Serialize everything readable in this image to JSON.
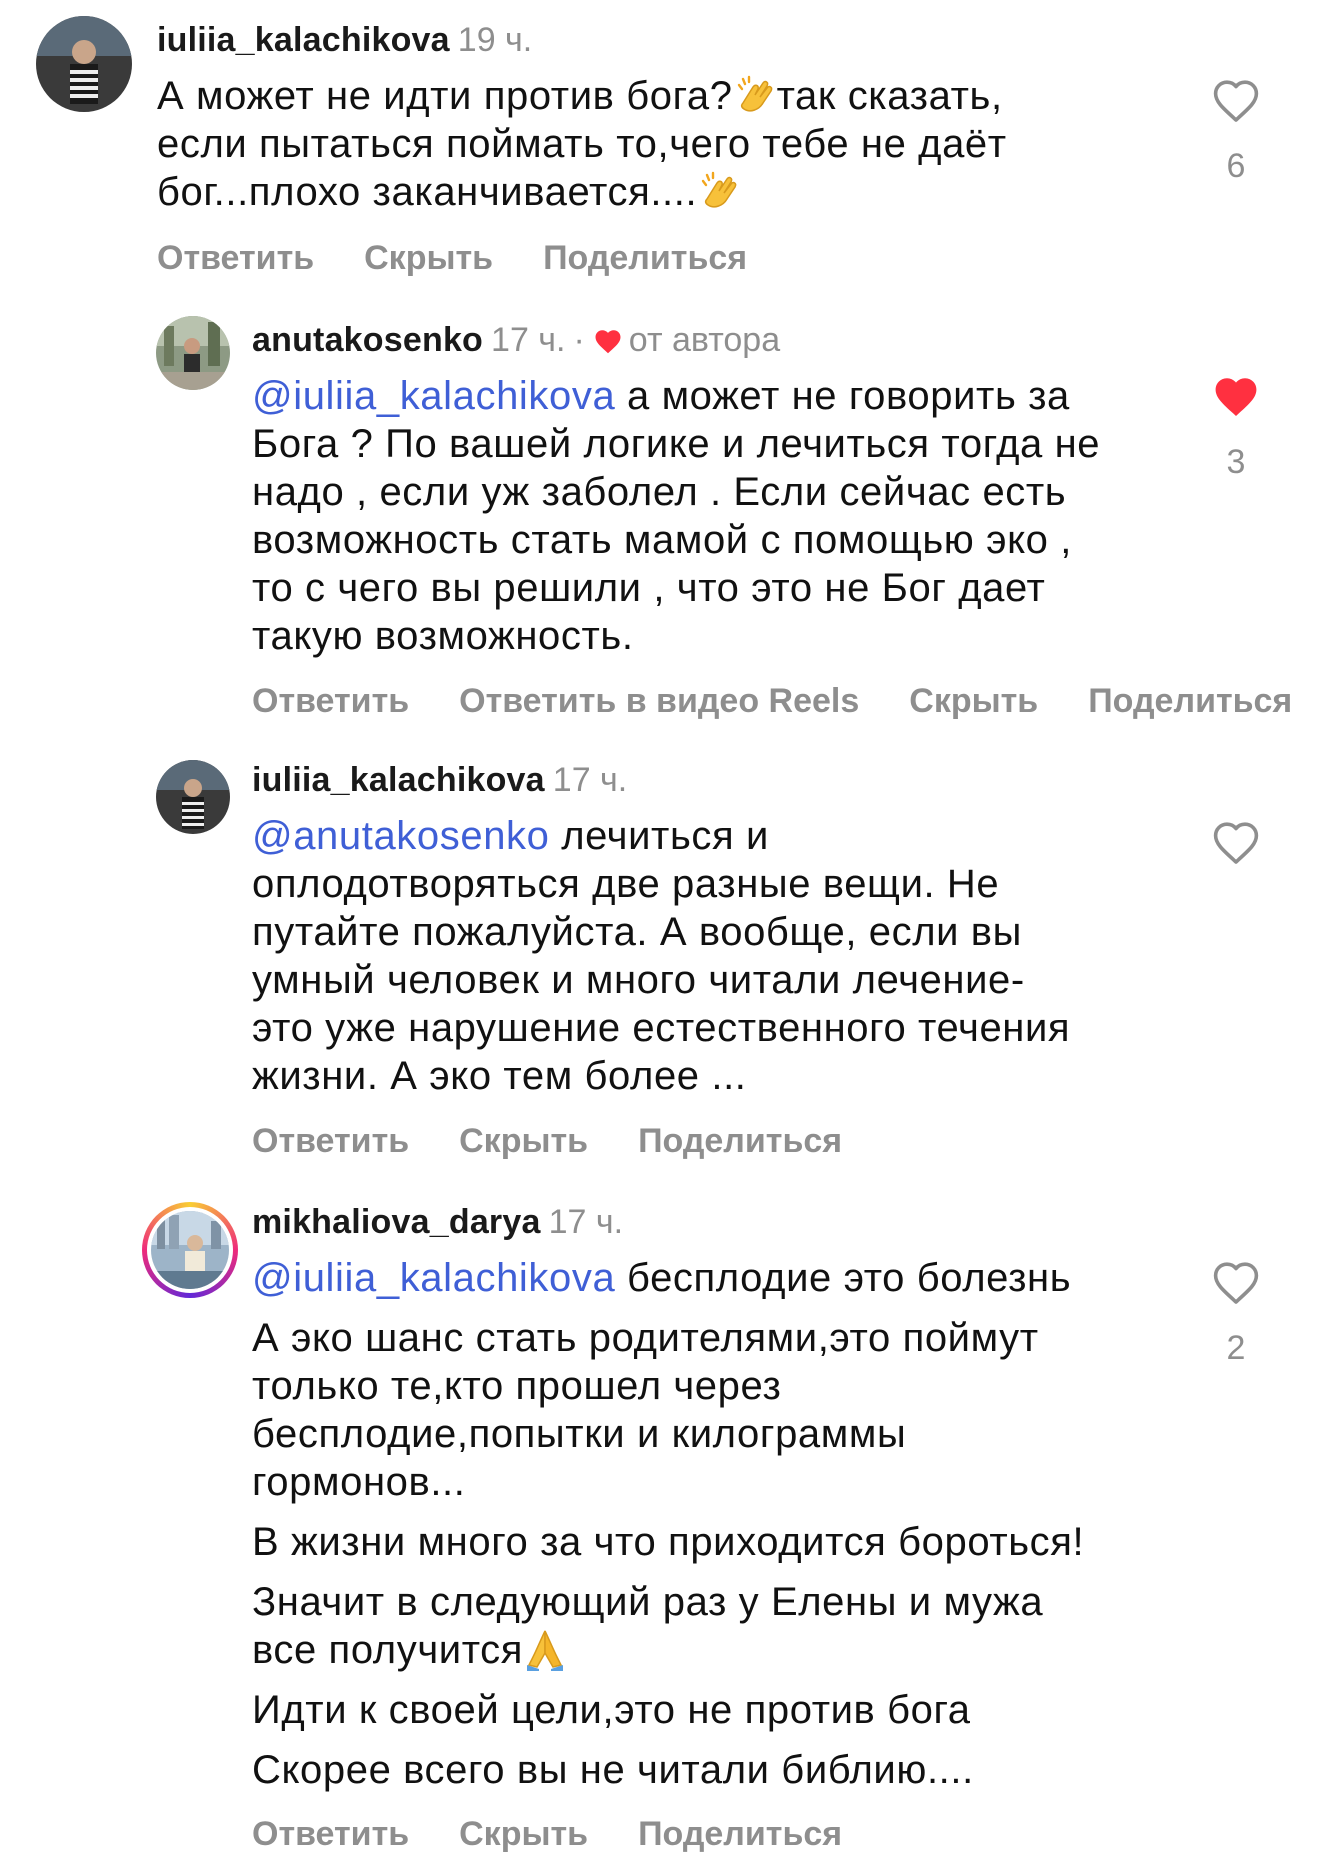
{
  "comments": [
    {
      "username": "iuliia_kalachikova",
      "time": "19 ч.",
      "lines": [
        {
          "segs": [
            {
              "text": "А может не идти против бога?"
            },
            {
              "emoji": "clap"
            },
            {
              "text": "так сказать,"
            }
          ]
        },
        {
          "segs": [
            {
              "text": "если пытаться поймать то,чего тебе не даёт"
            }
          ]
        },
        {
          "segs": [
            {
              "text": "бог...плохо заканчивается...."
            },
            {
              "emoji": "clap"
            }
          ]
        }
      ],
      "actions": [
        "Ответить",
        "Скрыть",
        "Поделиться"
      ],
      "likes": "6",
      "liked": false
    },
    {
      "username": "anutakosenko",
      "time": "17 ч.",
      "dot": "·",
      "by_author": "от автора",
      "lines": [
        {
          "segs": [
            {
              "mention": "@iuliia_kalachikova"
            },
            {
              "text": " а может не говорить за"
            }
          ]
        },
        {
          "segs": [
            {
              "text": "Бога ? По вашей логике и лечиться тогда не"
            }
          ]
        },
        {
          "segs": [
            {
              "text": "надо , если уж заболел . Если сейчас есть"
            }
          ]
        },
        {
          "segs": [
            {
              "text": "возможность стать мамой с помощью эко ,"
            }
          ]
        },
        {
          "segs": [
            {
              "text": "то с чего вы решили , что это не Бог дает"
            }
          ]
        },
        {
          "segs": [
            {
              "text": "такую возможность."
            }
          ]
        }
      ],
      "actions": [
        "Ответить",
        "Ответить в видео Reels",
        "Скрыть",
        "Поделиться"
      ],
      "likes": "3",
      "liked": true
    },
    {
      "username": "iuliia_kalachikova",
      "time": "17 ч.",
      "lines": [
        {
          "segs": [
            {
              "mention": "@anutakosenko"
            },
            {
              "text": " лечиться  и"
            }
          ]
        },
        {
          "segs": [
            {
              "text": "оплодотворяться две разные вещи. Не"
            }
          ]
        },
        {
          "segs": [
            {
              "text": "путайте пожалуйста. А вообще, если вы"
            }
          ]
        },
        {
          "segs": [
            {
              "text": "умный человек и много читали лечение-"
            }
          ]
        },
        {
          "segs": [
            {
              "text": "это уже нарушение естественного течения"
            }
          ]
        },
        {
          "segs": [
            {
              "text": "жизни. А эко тем более ..."
            }
          ]
        }
      ],
      "actions": [
        "Ответить",
        "Скрыть",
        "Поделиться"
      ],
      "likes": "",
      "liked": false
    },
    {
      "username": "mikhaliova_darya",
      "time": "17 ч.",
      "lines": [
        {
          "segs": [
            {
              "mention": "@iuliia_kalachikova"
            },
            {
              "text": " бесплодие это болезнь"
            }
          ]
        },
        {
          "gap": true,
          "segs": [
            {
              "text": "А эко шанс стать родителями,это поймут"
            }
          ]
        },
        {
          "segs": [
            {
              "text": "только те,кто прошел через"
            }
          ]
        },
        {
          "segs": [
            {
              "text": "бесплодие,попытки и килограммы"
            }
          ]
        },
        {
          "segs": [
            {
              "text": "гормонов..."
            }
          ]
        },
        {
          "gap": true,
          "segs": [
            {
              "text": "В жизни много за что приходится бороться!"
            }
          ]
        },
        {
          "gap": true,
          "segs": [
            {
              "text": "Значит в следующий раз у Елены и мужа"
            }
          ]
        },
        {
          "segs": [
            {
              "text": "все получится"
            },
            {
              "emoji": "pray"
            }
          ]
        },
        {
          "gap": true,
          "segs": [
            {
              "text": "Идти к своей цели,это не против бога"
            }
          ]
        },
        {
          "gap": true,
          "segs": [
            {
              "text": "Скорее всего вы не читали библию...."
            }
          ]
        }
      ],
      "actions": [
        "Ответить",
        "Скрыть",
        "Поделиться"
      ],
      "likes": "2",
      "liked": false
    }
  ],
  "colors": {
    "mention": "#3f5fd6",
    "secondary_text": "#8e8e8e",
    "liked_heart": "#ff3040"
  }
}
